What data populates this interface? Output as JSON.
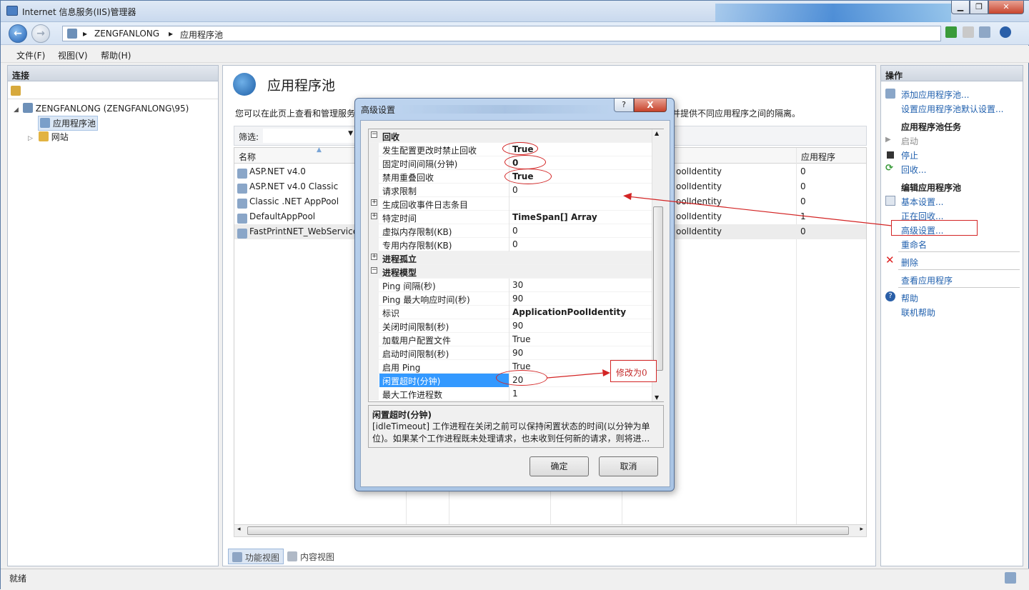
{
  "window": {
    "title": "Internet 信息服务(IIS)管理器"
  },
  "address": {
    "segments": [
      "ZENGFANLONG",
      "应用程序池"
    ]
  },
  "menu": {
    "items": [
      "文件(F)",
      "视图(V)",
      "帮助(H)"
    ]
  },
  "left_pane": {
    "header": "连接",
    "tree": {
      "server": "ZENGFANLONG (ZENGFANLONG\\95)",
      "app_pools": "应用程序池",
      "sites": "网站"
    }
  },
  "center": {
    "title": "应用程序池",
    "description": "您可以在此页上查看和管理服务",
    "description_tail": "并提供不同应用程序之间的隔离。",
    "filter_label": "筛选:",
    "columns": {
      "name": "名称",
      "apps": "应用程序"
    },
    "rows": [
      {
        "name": "ASP.NET v4.0",
        "identity": "oolIdentity",
        "apps": "0"
      },
      {
        "name": "ASP.NET v4.0 Classic",
        "identity": "oolIdentity",
        "apps": "0"
      },
      {
        "name": "Classic .NET AppPool",
        "identity": "oolIdentity",
        "apps": "0"
      },
      {
        "name": "DefaultAppPool",
        "identity": "oolIdentity",
        "apps": "1"
      },
      {
        "name": "FastPrintNET_WebService",
        "identity": "oolIdentity",
        "apps": "0"
      }
    ],
    "view_tabs": {
      "features": "功能视图",
      "content": "内容视图"
    }
  },
  "right_pane": {
    "header": "操作",
    "add_pool": "添加应用程序池...",
    "set_defaults": "设置应用程序池默认设置...",
    "tasks_header": "应用程序池任务",
    "start": "启动",
    "stop": "停止",
    "recycle": "回收...",
    "edit_header": "编辑应用程序池",
    "basic": "基本设置...",
    "recycling": "正在回收...",
    "advanced": "高级设置...",
    "rename": "重命名",
    "delete": "删除",
    "view_apps": "查看应用程序",
    "help": "帮助",
    "online_help": "联机帮助"
  },
  "status": {
    "text": "就绪"
  },
  "dialog": {
    "title": "高级设置",
    "help_btn": "?",
    "close_btn": "X",
    "properties": [
      {
        "kind": "cat",
        "exp": "⊟",
        "name": "回收"
      },
      {
        "kind": "prop",
        "name": "发生配置更改时禁止回收",
        "value": "True",
        "bold": true
      },
      {
        "kind": "prop",
        "name": "固定时间间隔(分钟)",
        "value": "0",
        "bold": true
      },
      {
        "kind": "prop",
        "name": "禁用重叠回收",
        "value": "True",
        "bold": true
      },
      {
        "kind": "prop",
        "name": "请求限制",
        "value": "0"
      },
      {
        "kind": "prop",
        "exp": "⊞",
        "name": "生成回收事件日志条目",
        "value": ""
      },
      {
        "kind": "prop",
        "exp": "⊞",
        "name": "特定时间",
        "value": "TimeSpan[] Array",
        "bold": true
      },
      {
        "kind": "prop",
        "name": "虚拟内存限制(KB)",
        "value": "0"
      },
      {
        "kind": "prop",
        "name": "专用内存限制(KB)",
        "value": "0"
      },
      {
        "kind": "cat",
        "exp": "⊞",
        "name": "进程孤立"
      },
      {
        "kind": "cat",
        "exp": "⊟",
        "name": "进程模型"
      },
      {
        "kind": "prop",
        "name": "Ping 间隔(秒)",
        "value": "30"
      },
      {
        "kind": "prop",
        "name": "Ping 最大响应时间(秒)",
        "value": "90"
      },
      {
        "kind": "prop",
        "name": "标识",
        "value": "ApplicationPoolIdentity",
        "bold": true
      },
      {
        "kind": "prop",
        "name": "关闭时间限制(秒)",
        "value": "90"
      },
      {
        "kind": "prop",
        "name": "加载用户配置文件",
        "value": "True"
      },
      {
        "kind": "prop",
        "name": "启动时间限制(秒)",
        "value": "90"
      },
      {
        "kind": "prop",
        "name": "启用 Ping",
        "value": "True"
      },
      {
        "kind": "prop",
        "name": "闲置超时(分钟)",
        "value": "20",
        "selected": true
      },
      {
        "kind": "prop",
        "name": "最大工作进程数",
        "value": "1"
      }
    ],
    "desc_title": "闲置超时(分钟)",
    "desc_text": "[idleTimeout] 工作进程在关闭之前可以保持闲置状态的时间(以分钟为单位)。如果某个工作进程既未处理请求，也未收到任何新的请求，则将进...",
    "ok": "确定",
    "cancel": "取消"
  },
  "annotation": {
    "note": "修改为0",
    "color": "#d32424"
  }
}
